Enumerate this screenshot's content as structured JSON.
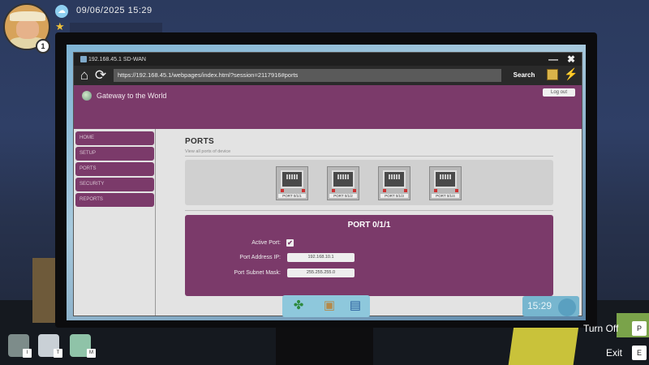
{
  "hud": {
    "datetime": "09/06/2025  15:29",
    "level": "1"
  },
  "window": {
    "title": "192.168.45.1 SD-WAN",
    "minimize": "—",
    "close": "✖"
  },
  "browser": {
    "url": "https://192.168.45.1/webpages/index.html?session=2117916#ports",
    "search_label": "Search"
  },
  "site": {
    "title": "Gateway to the World",
    "logout": "Log out"
  },
  "sidebar": {
    "items": [
      {
        "label": "HOME"
      },
      {
        "label": "SETUP"
      },
      {
        "label": "PORTS"
      },
      {
        "label": "SECURITY"
      },
      {
        "label": "REPORTS"
      }
    ]
  },
  "ports_page": {
    "title": "PORTS",
    "subtitle": "View all ports of device",
    "ports": [
      {
        "label": "PORT 0/1/1"
      },
      {
        "label": "PORT 0/1/2"
      },
      {
        "label": "PORT 0/1/3"
      },
      {
        "label": "PORT 0/1/4"
      }
    ]
  },
  "port_config": {
    "title": "PORT 0/1/1",
    "active_label": "Active Port:",
    "active_checked": "✔",
    "ip_label": "Port Address IP:",
    "ip_value": "192.168.10.1",
    "mask_label": "Port Subnet Mask:",
    "mask_value": "255.255.255.0"
  },
  "taskbar": {
    "clock": "15:29"
  },
  "inventory": {
    "keys": [
      "I",
      "T",
      "M"
    ]
  },
  "actions": {
    "turn_off_label": "Turn Off",
    "turn_off_key": "P",
    "exit_label": "Exit",
    "exit_key": "E"
  }
}
